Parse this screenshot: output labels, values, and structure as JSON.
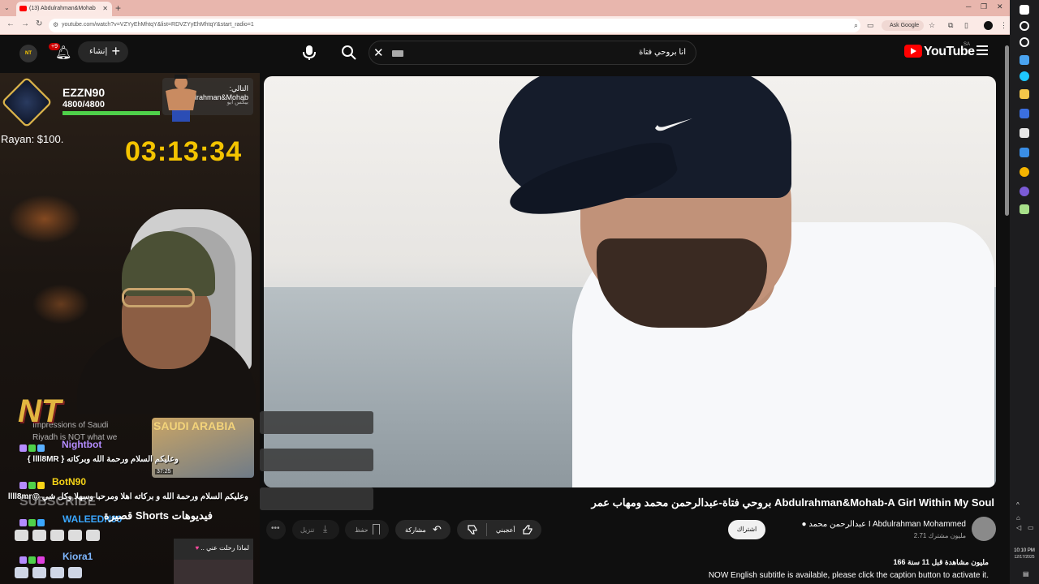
{
  "browser": {
    "tab_title": "(13) Abdulrahman&Mohab",
    "url": "youtube.com/watch?v=VZYyEhMhtqY&list=RDVZYyEhMhtqY&start_radio=1",
    "ask_google": "Ask Google"
  },
  "youtube": {
    "logo_text": "YouTube",
    "country": "SA",
    "search_query": "انا بروحي فتاة",
    "create_label": "إنشاء",
    "notifications": "+9",
    "channel_avatar": "NT"
  },
  "video": {
    "title": "بروحي فتاة-عبدالرحمن محمد ومهاب عمر Abdulrahman&Mohab-A Girl Within My Soul",
    "channel_name": "عبدالرحمن محمد I Abdulrahman Mohammed",
    "subscribers": "2.71 مليون مشترك",
    "subscribe_label": "اشتراك",
    "like_label": "أعجبني",
    "share_label": "مشاركة",
    "save_label": "حفظ",
    "download_label": "تنزيل",
    "views": "166 مليون مشاهدة  قبل 11 سنة",
    "description_line": "NOW English subtitle is available, please click the caption button to activate it."
  },
  "stream": {
    "player_name": "EZZN90",
    "xp_text": "4800/4800",
    "xp_fraction": 1.0,
    "next_label": "التالي:",
    "next_sub": "بيكس ايو",
    "next_title": "Abdulrahman&Mohab",
    "donation": "Rayan: $100.",
    "timer": "03:13:34",
    "shorts_caption": "SAUDI ARABIA",
    "shorts_duration": "37:25",
    "bg_text_1": "Impressions of Saudi",
    "bg_text_2": "Riyadh is NOT what we",
    "chat": [
      {
        "name": "Nightbot",
        "color": "#b48cff",
        "message": "وعليكم السلام ورحمة الله وبركاته { llll8MR }"
      },
      {
        "name": "BotN90",
        "color": "#f7d417",
        "message": "وعليكم السلام ورحمة الله و بركاته اهلا ومرحبا وسهلا وكل شي @llll8mr"
      },
      {
        "name": "WALEEDN90",
        "color": "#3aa7ff",
        "message": ""
      },
      {
        "name": "Kiora1",
        "color": "#7fb8ff",
        "message": ""
      }
    ],
    "shorts_heading": "فيديوهات Shorts قصيرة",
    "short_card_title": "لماذا رحلت عني ..",
    "subscribe_overlay": "SUBSCRIBE"
  },
  "taskbar": {
    "time": "10:10 PM",
    "date": "12/17/2025"
  }
}
